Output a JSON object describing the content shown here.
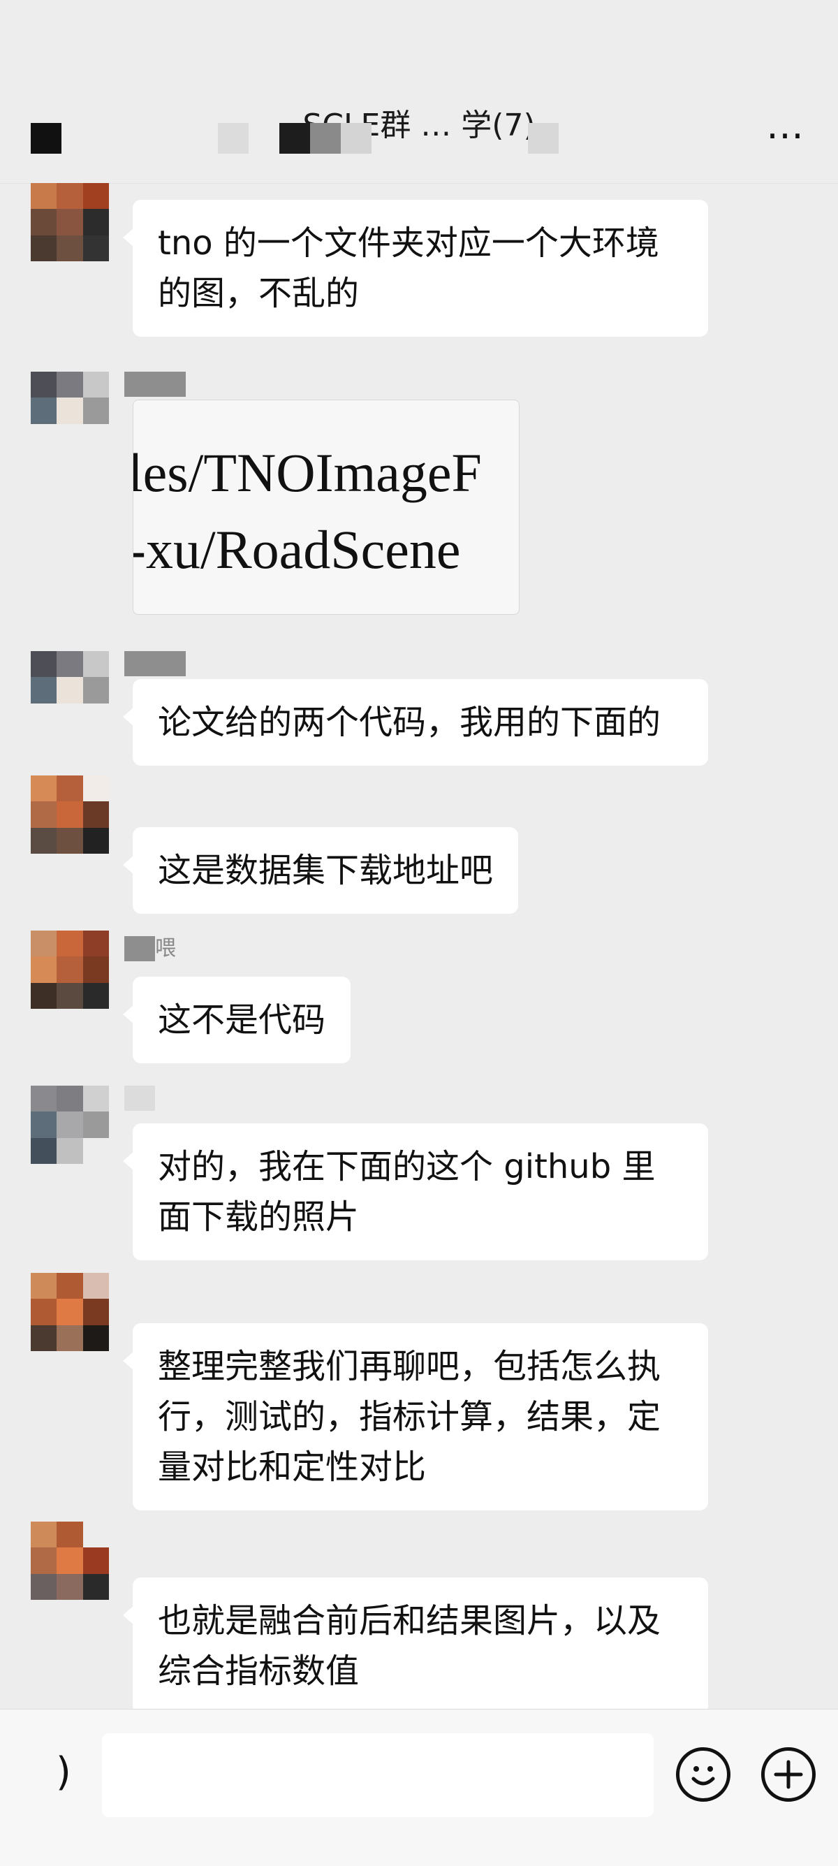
{
  "header": {
    "title": "SCLE群 … 学(7)",
    "more_label": "…"
  },
  "messages": [
    {
      "id": "m1",
      "type": "text",
      "text": "tno 的一个文件夹对应一个大环境的图，不乱的"
    },
    {
      "id": "m2",
      "type": "image",
      "image_lines": [
        "les/TNOImageF",
        "-xu/RoadScene"
      ]
    },
    {
      "id": "m3",
      "type": "text",
      "text": "论文给的两个代码，我用的下面的"
    },
    {
      "id": "m4",
      "type": "text",
      "text": "这是数据集下载地址吧"
    },
    {
      "id": "m5",
      "type": "text",
      "sender_fragment": "喂",
      "text": "这不是代码"
    },
    {
      "id": "m6",
      "type": "text",
      "text": "对的，我在下面的这个 github 里面下载的照片"
    },
    {
      "id": "m7",
      "type": "text",
      "text": "整理完整我们再聊吧，包括怎么执行，测试的，指标计算，结果，定量对比和定性对比"
    },
    {
      "id": "m8",
      "type": "text",
      "text": "也就是融合前后和结果图片，以及综合指标数值"
    }
  ],
  "input_bar": {
    "voice_label": ")",
    "input_value": "",
    "emoji_icon": "smile-icon",
    "plus_icon": "plus-icon"
  },
  "colors": {
    "background": "#ededed",
    "bubble": "#ffffff",
    "input_bar": "#f7f7f7"
  }
}
